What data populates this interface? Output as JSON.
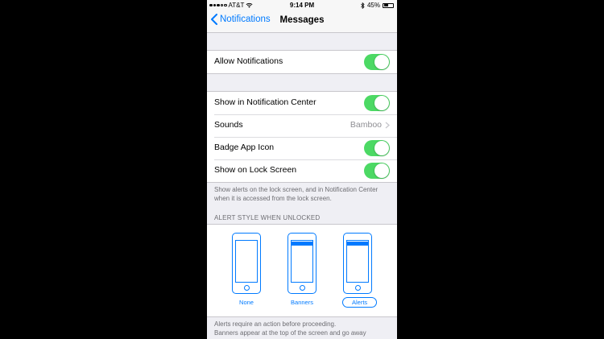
{
  "status_bar": {
    "carrier": "AT&T",
    "time": "9:14 PM",
    "battery": "45%",
    "battery_level": 0.45
  },
  "nav": {
    "back_label": "Notifications",
    "title": "Messages"
  },
  "allow_group": [
    {
      "label": "Allow Notifications",
      "type": "toggle",
      "on": true
    }
  ],
  "settings_group": [
    {
      "label": "Show in Notification Center",
      "type": "toggle",
      "on": true
    },
    {
      "label": "Sounds",
      "type": "detail",
      "value": "Bamboo"
    },
    {
      "label": "Badge App Icon",
      "type": "toggle",
      "on": true
    },
    {
      "label": "Show on Lock Screen",
      "type": "toggle",
      "on": true
    }
  ],
  "lock_screen_note": "Show alerts on the lock screen, and in Notification Center when it is accessed from the lock screen.",
  "alert_style": {
    "header": "ALERT STYLE WHEN UNLOCKED",
    "options": [
      {
        "label": "None",
        "selected": false
      },
      {
        "label": "Banners",
        "selected": false
      },
      {
        "label": "Alerts",
        "selected": true
      }
    ]
  },
  "footer_note": {
    "line1": "Alerts require an action before proceeding.",
    "line2": "Banners appear at the top of the screen and go away"
  },
  "colors": {
    "accent": "#007aff",
    "toggle_on": "#4cd964",
    "background": "#efeff4"
  }
}
